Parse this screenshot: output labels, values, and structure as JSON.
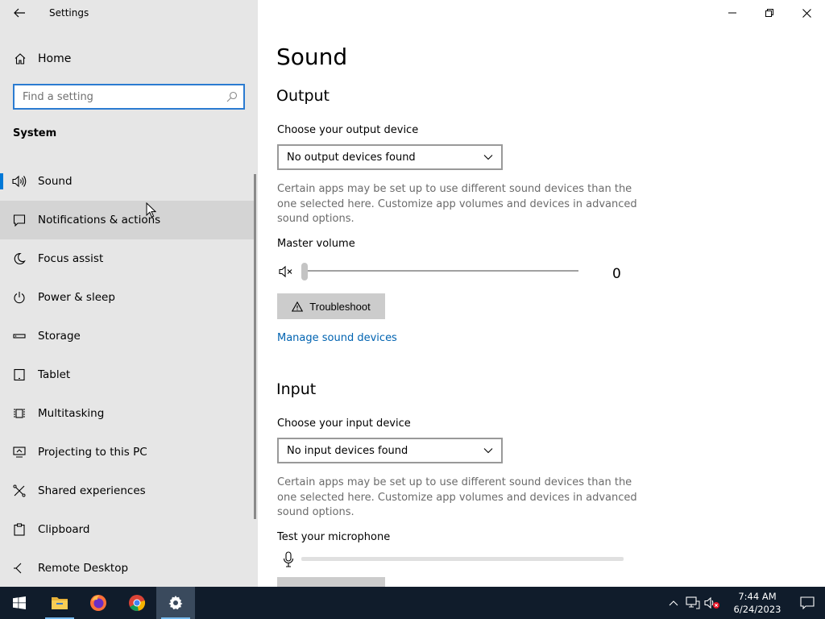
{
  "window": {
    "title": "Settings"
  },
  "sidebar": {
    "home_label": "Home",
    "search_placeholder": "Find a setting",
    "section": "System",
    "items": [
      {
        "label": "Sound",
        "icon": "speaker-icon"
      },
      {
        "label": "Notifications & actions",
        "icon": "notification-icon"
      },
      {
        "label": "Focus assist",
        "icon": "moon-icon"
      },
      {
        "label": "Power & sleep",
        "icon": "power-icon"
      },
      {
        "label": "Storage",
        "icon": "storage-icon"
      },
      {
        "label": "Tablet",
        "icon": "tablet-icon"
      },
      {
        "label": "Multitasking",
        "icon": "multitasking-icon"
      },
      {
        "label": "Projecting to this PC",
        "icon": "projecting-icon"
      },
      {
        "label": "Shared experiences",
        "icon": "shared-icon"
      },
      {
        "label": "Clipboard",
        "icon": "clipboard-icon"
      },
      {
        "label": "Remote Desktop",
        "icon": "remote-desktop-icon"
      }
    ]
  },
  "main": {
    "title": "Sound",
    "output": {
      "heading": "Output",
      "device_label": "Choose your output device",
      "device_value": "No output devices found",
      "description": "Certain apps may be set up to use different sound devices than the one selected here. Customize app volumes and devices in advanced sound options.",
      "volume_label": "Master volume",
      "volume_value": "0",
      "volume_level": 0,
      "troubleshoot_label": "Troubleshoot",
      "manage_link": "Manage sound devices"
    },
    "input": {
      "heading": "Input",
      "device_label": "Choose your input device",
      "device_value": "No input devices found",
      "description": "Certain apps may be set up to use different sound devices than the one selected here. Customize app volumes and devices in advanced sound options.",
      "test_label": "Test your microphone",
      "mic_level": 0
    }
  },
  "taskbar": {
    "time": "7:44 AM",
    "date": "6/24/2023"
  },
  "colors": {
    "accent": "#0078d7",
    "link": "#0063b1",
    "sidebar_bg": "#e6e6e6",
    "taskbar_bg": "#101c2b"
  }
}
